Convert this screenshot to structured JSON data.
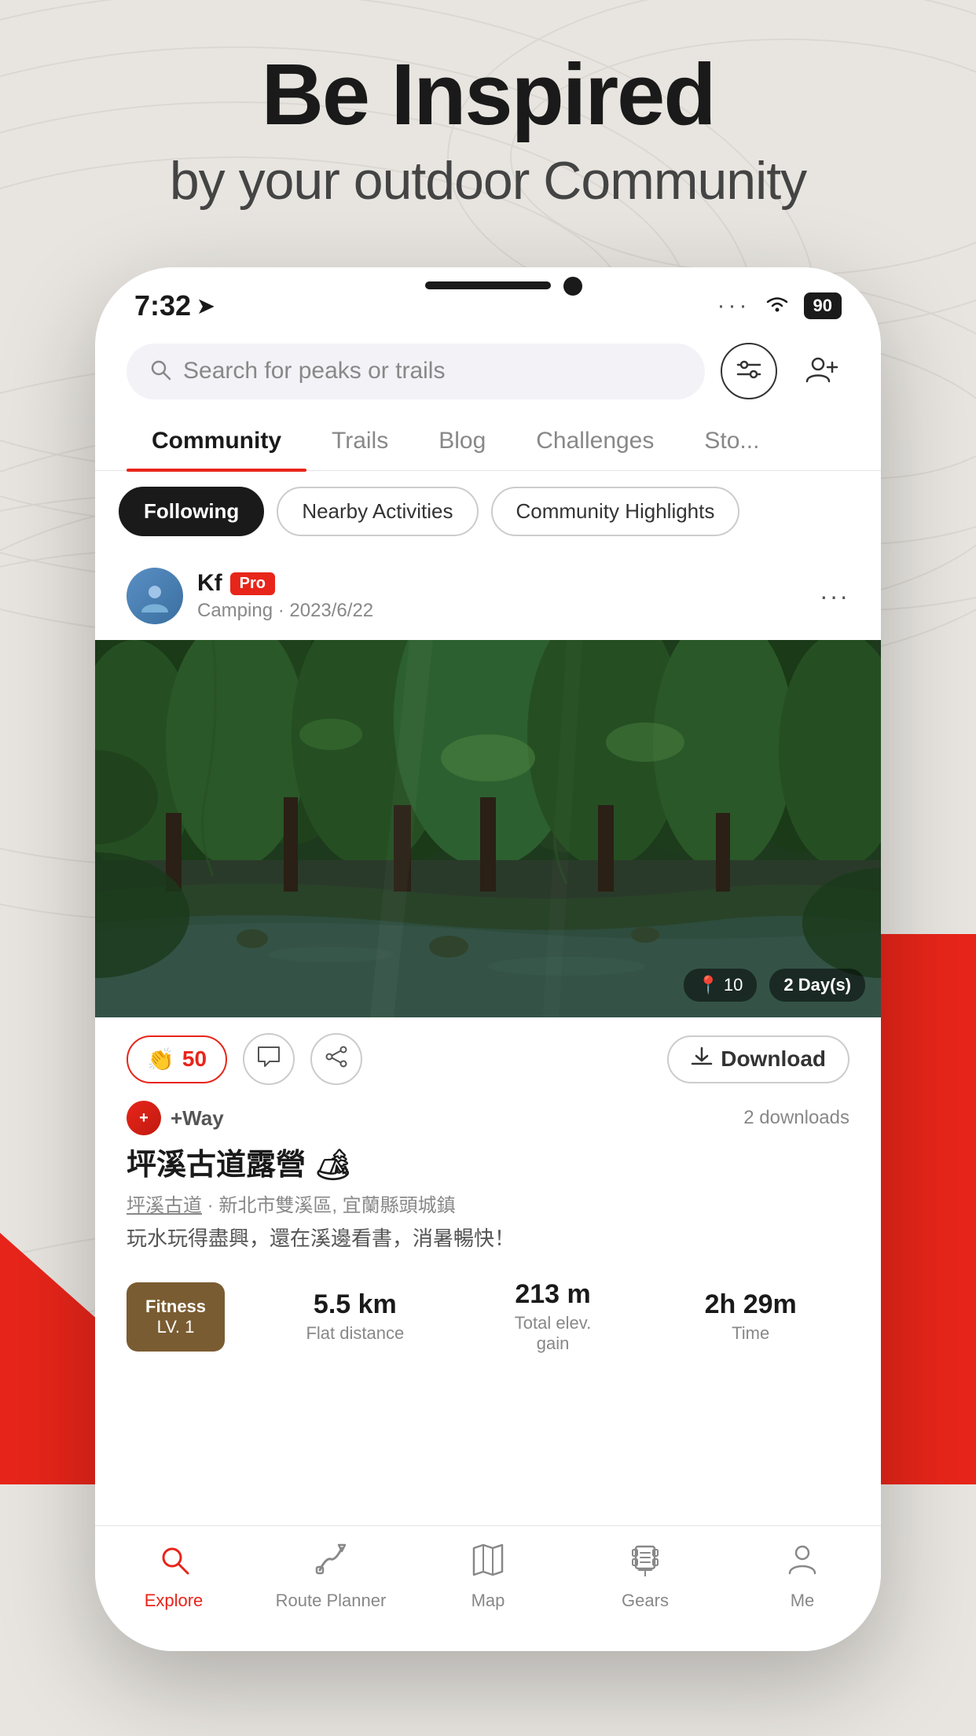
{
  "hero": {
    "title": "Be Inspired",
    "subtitle": "by your outdoor Community"
  },
  "status_bar": {
    "time": "7:32",
    "arrow": "▶",
    "dots": "···",
    "wifi": "wifi",
    "battery": "90"
  },
  "search": {
    "placeholder": "Search for peaks or trails"
  },
  "nav_tabs": [
    {
      "label": "Community",
      "active": true
    },
    {
      "label": "Trails",
      "active": false
    },
    {
      "label": "Blog",
      "active": false
    },
    {
      "label": "Challenges",
      "active": false
    },
    {
      "label": "Sto...",
      "active": false
    }
  ],
  "sub_tabs": [
    {
      "label": "Following",
      "active": true
    },
    {
      "label": "Nearby Activities",
      "active": false
    },
    {
      "label": "Community Highlights",
      "active": false
    }
  ],
  "post": {
    "user_name": "Kf",
    "user_badge": "Pro",
    "user_meta": "Camping · 2023/6/22",
    "location_icon": "📍",
    "location_count": "10",
    "day_label": "2 Day(s)",
    "clap_count": "50",
    "downloads_count": "2 downloads",
    "download_label": "Download",
    "waypoint_user": "+Way",
    "title": "坪溪古道露營 🏕",
    "location_trail": "坪溪古道",
    "location_area": "新北市雙溪區, 宜蘭縣頭城鎮",
    "description": "玩水玩得盡興，還在溪邊看書，消暑暢快！",
    "fitness_label": "Fitness",
    "fitness_level": "LV. 1",
    "stat1_value": "5.5 km",
    "stat1_label": "Flat distance",
    "stat2_value": "213 m",
    "stat2_label": "Total elev.\ngain",
    "stat3_value": "2h 29m",
    "stat3_label": "Time"
  },
  "bottom_nav": [
    {
      "label": "Explore",
      "active": true,
      "icon": "search"
    },
    {
      "label": "Route Planner",
      "active": false,
      "icon": "route"
    },
    {
      "label": "Map",
      "active": false,
      "icon": "map"
    },
    {
      "label": "Gears",
      "active": false,
      "icon": "gears"
    },
    {
      "label": "Me",
      "active": false,
      "icon": "person"
    }
  ]
}
